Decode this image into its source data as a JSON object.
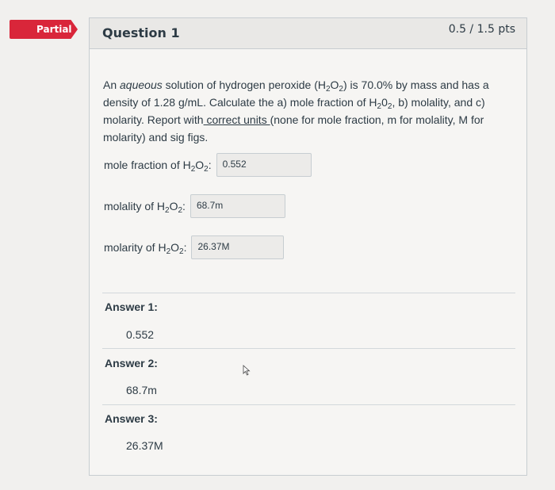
{
  "badge": {
    "label": "Partial"
  },
  "question": {
    "title": "Question 1",
    "points": "0.5 / 1.5 pts",
    "text": {
      "p1_a": "An ",
      "p1_aqueous": "aqueous",
      "p1_b": " solution of hydrogen peroxide (H",
      "p1_c": "2",
      "p1_d": "O",
      "p1_e": "2",
      "p1_f": ") is 70.0% by mass and has a density of 1.28 g/mL. Calculate the a) mole fraction of H",
      "p1_g": "2",
      "p1_h": "0",
      "p1_i": "2",
      "p1_j": ", b) molality, and c) molarity. Report with",
      "p1_k": " correct units ",
      "p1_l": "(none for mole fraction, m for molality, M for molarity) and sig figs."
    },
    "fields": [
      {
        "label_a": "mole fraction of H",
        "label_sub1": "2",
        "label_b": "O",
        "label_sub2": "2",
        "label_c": ":",
        "value": "0.552"
      },
      {
        "label_a": "molality of H",
        "label_sub1": "2",
        "label_b": "O",
        "label_sub2": "2",
        "label_c": ":",
        "value": "68.7m"
      },
      {
        "label_a": "molarity of H",
        "label_sub1": "2",
        "label_b": "O",
        "label_sub2": "2",
        "label_c": ":",
        "value": "26.37M"
      }
    ],
    "answers": [
      {
        "label": "Answer 1:",
        "value": "0.552"
      },
      {
        "label": "Answer 2:",
        "value": "68.7m"
      },
      {
        "label": "Answer 3:",
        "value": "26.37M"
      }
    ]
  }
}
